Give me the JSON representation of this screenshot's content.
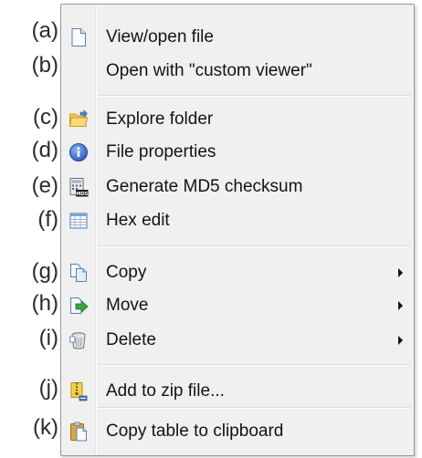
{
  "markers": [
    "(a)",
    "(b)",
    "(c)",
    "(d)",
    "(e)",
    "(f)",
    "(g)",
    "(h)",
    "(i)",
    "(j)",
    "(k)"
  ],
  "menu": {
    "items": [
      {
        "label": "View/open file",
        "icon": "file-icon"
      },
      {
        "label": "Open with \"custom viewer\"",
        "icon": null
      },
      {
        "label": "Explore folder",
        "icon": "folder-icon"
      },
      {
        "label": "File properties",
        "icon": "info-icon"
      },
      {
        "label": "Generate MD5 checksum",
        "icon": "md5-calculator-icon"
      },
      {
        "label": "Hex edit",
        "icon": "hex-grid-icon"
      },
      {
        "label": "Copy",
        "icon": "copy-icon",
        "submenu": true
      },
      {
        "label": "Move",
        "icon": "move-icon",
        "submenu": true
      },
      {
        "label": "Delete",
        "icon": "trash-icon",
        "submenu": true
      },
      {
        "label": "Add to zip file...",
        "icon": "zip-icon"
      },
      {
        "label": "Copy table to clipboard",
        "icon": "clipboard-icon"
      }
    ]
  },
  "colors": {
    "menu_background": "#f0f0f0",
    "menu_border": "#979797",
    "text": "#141414",
    "info_blue": "#3f6fc8",
    "move_green": "#3da33d",
    "folder_yellow": "#f3c84a"
  }
}
